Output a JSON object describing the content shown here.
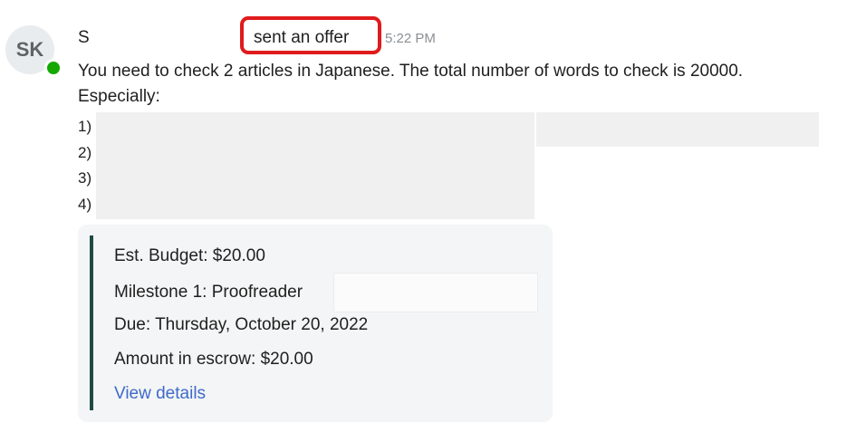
{
  "avatar": {
    "initials": "SK",
    "presence": "online",
    "presence_color": "#14a800"
  },
  "header": {
    "sender_name": "S",
    "action_text": "sent an offer",
    "timestamp": "5:22 PM",
    "highlight_color": "#e01b1b"
  },
  "message": {
    "line1": "You need to check 2 articles in Japanese. The total number of words to check is 20000.",
    "line2": "Especially:",
    "list_markers": [
      "1)",
      "2)",
      "3)",
      "4)"
    ]
  },
  "offer_card": {
    "budget": "Est. Budget: $20.00",
    "milestone": "Milestone 1: Proofreader",
    "due": "Due: Thursday, October 20, 2022",
    "escrow": "Amount in escrow: $20.00",
    "link_label": "View details",
    "link_color": "#3e6ac9",
    "accent_color": "#1e4b44"
  }
}
